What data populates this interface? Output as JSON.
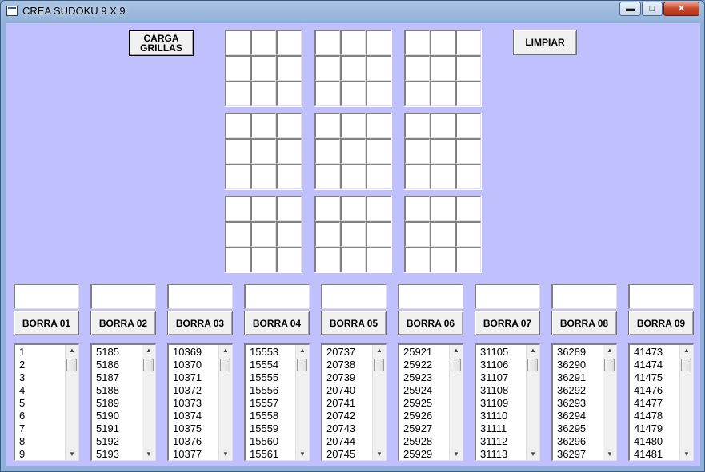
{
  "window": {
    "title": "CREA SUDOKU 9 X 9",
    "controls": {
      "minimize": "▬",
      "maximize": "□",
      "close": "✕"
    }
  },
  "buttons": {
    "carga": "CARGA\nGRILLAS",
    "limpiar": "LIMPIAR"
  },
  "columns": [
    {
      "borra": "BORRA 01",
      "items": [
        "1",
        "2",
        "3",
        "4",
        "5",
        "6",
        "7",
        "8",
        "9"
      ]
    },
    {
      "borra": "BORRA 02",
      "items": [
        "5185",
        "5186",
        "5187",
        "5188",
        "5189",
        "5190",
        "5191",
        "5192",
        "5193"
      ]
    },
    {
      "borra": "BORRA 03",
      "items": [
        "10369",
        "10370",
        "10371",
        "10372",
        "10373",
        "10374",
        "10375",
        "10376",
        "10377"
      ]
    },
    {
      "borra": "BORRA 04",
      "items": [
        "15553",
        "15554",
        "15555",
        "15556",
        "15557",
        "15558",
        "15559",
        "15560",
        "15561"
      ]
    },
    {
      "borra": "BORRA 05",
      "items": [
        "20737",
        "20738",
        "20739",
        "20740",
        "20741",
        "20742",
        "20743",
        "20744",
        "20745"
      ]
    },
    {
      "borra": "BORRA 06",
      "items": [
        "25921",
        "25922",
        "25923",
        "25924",
        "25925",
        "25926",
        "25927",
        "25928",
        "25929"
      ]
    },
    {
      "borra": "BORRA 07",
      "items": [
        "31105",
        "31106",
        "31107",
        "31108",
        "31109",
        "31110",
        "31111",
        "31112",
        "31113"
      ]
    },
    {
      "borra": "BORRA 08",
      "items": [
        "36289",
        "36290",
        "36291",
        "36292",
        "36293",
        "36294",
        "36295",
        "36296",
        "36297"
      ]
    },
    {
      "borra": "BORRA 09",
      "items": [
        "41473",
        "41474",
        "41475",
        "41476",
        "41477",
        "41478",
        "41479",
        "41480",
        "41481"
      ]
    }
  ],
  "scrollbar": {
    "up": "▲",
    "down": "▼"
  }
}
